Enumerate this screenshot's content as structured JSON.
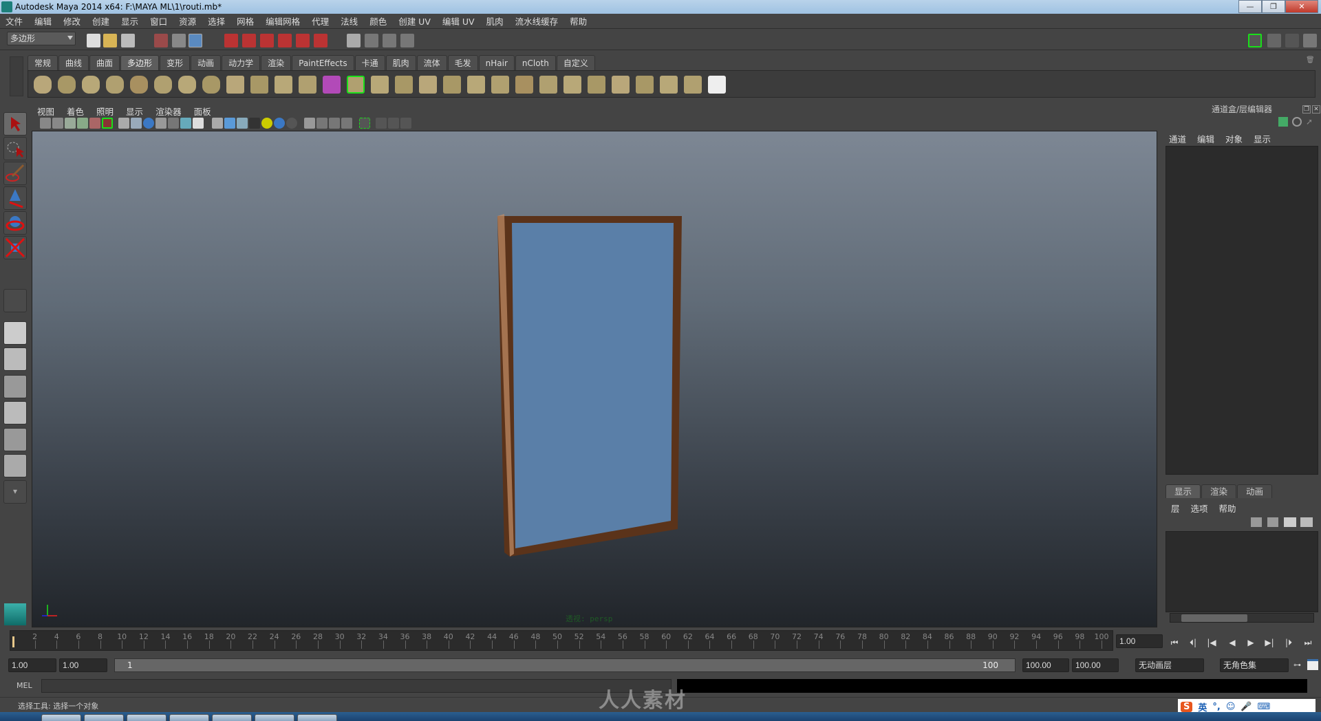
{
  "titlebar": {
    "title": "Autodesk Maya 2014 x64: F:\\MAYA  ML\\1\\routi.mb*",
    "minimize": "—",
    "restore": "❐",
    "close": "✕"
  },
  "menubar": [
    "文件",
    "编辑",
    "修改",
    "创建",
    "显示",
    "窗口",
    "资源",
    "选择",
    "网格",
    "编辑网格",
    "代理",
    "法线",
    "颜色",
    "创建 UV",
    "编辑 UV",
    "肌肉",
    "流水线缓存",
    "帮助"
  ],
  "statusline": {
    "mode": "多边形"
  },
  "shelf": {
    "tabs": [
      "常规",
      "曲线",
      "曲面",
      "多边形",
      "变形",
      "动画",
      "动力学",
      "渲染",
      "PaintEffects",
      "卡通",
      "肌肉",
      "流体",
      "毛发",
      "nHair",
      "nCloth",
      "自定义"
    ],
    "active_tab": "多边形",
    "icons": [
      "poly-sphere-icon",
      "poly-cube-icon",
      "poly-cylinder-icon",
      "poly-cone-icon",
      "poly-plane-icon",
      "poly-torus-icon",
      "poly-pyramid-icon",
      "poly-pipe-icon",
      "soccer-ball-icon",
      "separate-icon",
      "combine-icon",
      "smooth-icon",
      "subdiv-proxy-icon",
      "extrude-icon",
      "append-icon",
      "split-icon",
      "bridge-icon",
      "bevel-icon",
      "merge-icon",
      "insert-edgeloop-icon",
      "wedge-icon",
      "poke-icon",
      "duplicate-face-icon",
      "extract-icon",
      "planar-map-icon",
      "cylindrical-map-icon",
      "spherical-map-icon",
      "automatic-map-icon",
      "uv-editor-icon"
    ]
  },
  "panel": {
    "menus": [
      "视图",
      "着色",
      "照明",
      "显示",
      "渲染器",
      "面板"
    ],
    "camera_label": "透视: persp"
  },
  "tools": [
    "select-tool-icon",
    "lasso-tool-icon",
    "paint-select-icon",
    "move-tool-icon",
    "rotate-tool-icon",
    "scale-tool-icon",
    "last-tool-icon",
    "single-perspective-layout-icon",
    "four-view-layout-icon",
    "outliner-persp-layout-icon",
    "persp-graph-layout-icon",
    "hypershade-persp-layout-icon",
    "persp-graph-outliner-layout-icon",
    "more-layouts-icon"
  ],
  "channelbox": {
    "title": "通道盒/层编辑器",
    "menus": [
      "通道",
      "编辑",
      "对象",
      "显示"
    ],
    "layer_tabs": [
      "显示",
      "渲染",
      "动画"
    ],
    "active_layer_tab": "显示",
    "layer_menus": [
      "层",
      "选项",
      "帮助"
    ]
  },
  "timeline": {
    "ticks": [
      2,
      4,
      6,
      8,
      10,
      12,
      14,
      16,
      18,
      20,
      22,
      24,
      26,
      28,
      30,
      32,
      34,
      36,
      38,
      40,
      42,
      44,
      46,
      48,
      50,
      52,
      54,
      56,
      58,
      60,
      62,
      64,
      66,
      68,
      70,
      72,
      74,
      76,
      78,
      80,
      82,
      84,
      86,
      88,
      90,
      92,
      94,
      96,
      98,
      100
    ],
    "current_frame": "1.00",
    "range_start": "1.00",
    "playback_start": "1.00",
    "range_slider_start": "1",
    "range_slider_end": "100",
    "playback_end": "100.00",
    "range_end": "100.00",
    "anim_layer": "无动画层",
    "character_set": "无角色集",
    "playback_buttons": [
      "⏮",
      "⏴|",
      "|◀",
      "◀",
      "▶",
      "▶|",
      "|⏵",
      "⏭"
    ]
  },
  "commandline": {
    "label": "MEL",
    "value": ""
  },
  "helpline": {
    "text": "选择工具: 选择一个对象"
  },
  "ime": {
    "lang": "英",
    "punct": "°,"
  },
  "watermark": "人人素材",
  "colors": {
    "frame_wood": "#6b3a1a",
    "glass": "#5a7fa8",
    "accent_green": "#19e019"
  }
}
